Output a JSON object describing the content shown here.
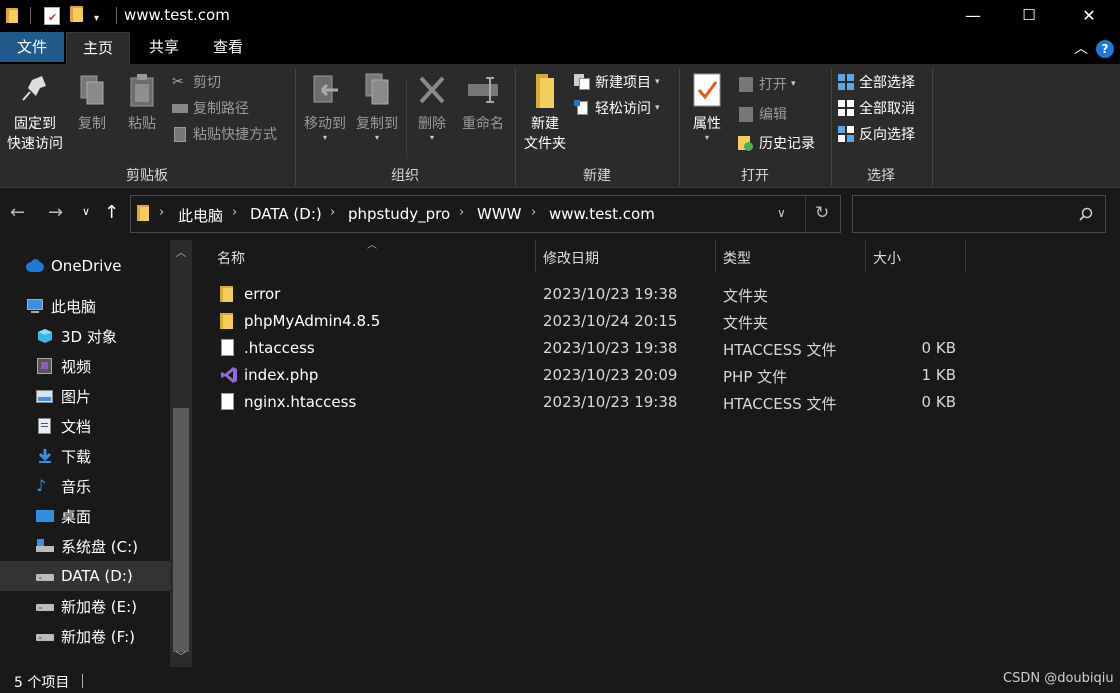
{
  "window": {
    "title": "www.test.com",
    "minimize": "—",
    "maximize": "☐",
    "close": "✕"
  },
  "tabs": {
    "file": "文件",
    "home": "主页",
    "share": "共享",
    "view": "查看",
    "help": "?"
  },
  "ribbon": {
    "clipboard": {
      "label": "剪贴板",
      "pin_line1": "固定到",
      "pin_line2": "快速访问",
      "copy": "复制",
      "paste": "粘贴",
      "cut": "剪切",
      "copy_path": "复制路径",
      "paste_shortcut": "粘贴快捷方式"
    },
    "organize": {
      "label": "组织",
      "move_to": "移动到",
      "copy_to": "复制到",
      "delete": "删除",
      "rename": "重命名"
    },
    "new": {
      "label": "新建",
      "new_folder_line1": "新建",
      "new_folder_line2": "文件夹",
      "new_item": "新建项目",
      "easy_access": "轻松访问"
    },
    "open": {
      "label": "打开",
      "properties": "属性",
      "open": "打开",
      "edit": "编辑",
      "history": "历史记录"
    },
    "select": {
      "label": "选择",
      "select_all": "全部选择",
      "select_none": "全部取消",
      "invert": "反向选择"
    }
  },
  "address": {
    "crumbs": [
      "此电脑",
      "DATA (D:)",
      "phpstudy_pro",
      "WWW",
      "www.test.com"
    ],
    "search_placeholder": ""
  },
  "navpane": {
    "items": [
      {
        "label": "OneDrive",
        "icon": "cloud-icon"
      },
      {
        "label": "此电脑",
        "icon": "computer-icon"
      },
      {
        "label": "3D 对象",
        "icon": "cube-icon"
      },
      {
        "label": "视频",
        "icon": "video-icon"
      },
      {
        "label": "图片",
        "icon": "picture-icon"
      },
      {
        "label": "文档",
        "icon": "document-icon"
      },
      {
        "label": "下载",
        "icon": "download-icon"
      },
      {
        "label": "音乐",
        "icon": "music-icon"
      },
      {
        "label": "桌面",
        "icon": "desktop-icon"
      },
      {
        "label": "系统盘 (C:)",
        "icon": "system-drive-icon"
      },
      {
        "label": "DATA (D:)",
        "icon": "drive-icon"
      },
      {
        "label": "新加卷 (E:)",
        "icon": "drive-icon"
      },
      {
        "label": "新加卷 (F:)",
        "icon": "drive-icon"
      }
    ]
  },
  "filelist": {
    "headers": {
      "name": "名称",
      "modified": "修改日期",
      "type": "类型",
      "size": "大小"
    },
    "rows": [
      {
        "name": "error",
        "modified": "2023/10/23 19:38",
        "type": "文件夹",
        "size": "",
        "icon": "folder-icon"
      },
      {
        "name": "phpMyAdmin4.8.5",
        "modified": "2023/10/24 20:15",
        "type": "文件夹",
        "size": "",
        "icon": "folder-icon"
      },
      {
        "name": ".htaccess",
        "modified": "2023/10/23 19:38",
        "type": "HTACCESS 文件",
        "size": "0 KB",
        "icon": "file-icon"
      },
      {
        "name": "index.php",
        "modified": "2023/10/23 20:09",
        "type": "PHP 文件",
        "size": "1 KB",
        "icon": "visual-studio-icon"
      },
      {
        "name": "nginx.htaccess",
        "modified": "2023/10/23 19:38",
        "type": "HTACCESS 文件",
        "size": "0 KB",
        "icon": "file-icon"
      }
    ]
  },
  "status": {
    "count": "5 个项目",
    "watermark": "CSDN @doubiqiu"
  },
  "colors": {
    "background": "#191919",
    "ribbon": "#2b2b2b",
    "file_tab": "#1f5a8c",
    "folder": "#f5cd5a",
    "accent": "#1e78d6"
  }
}
